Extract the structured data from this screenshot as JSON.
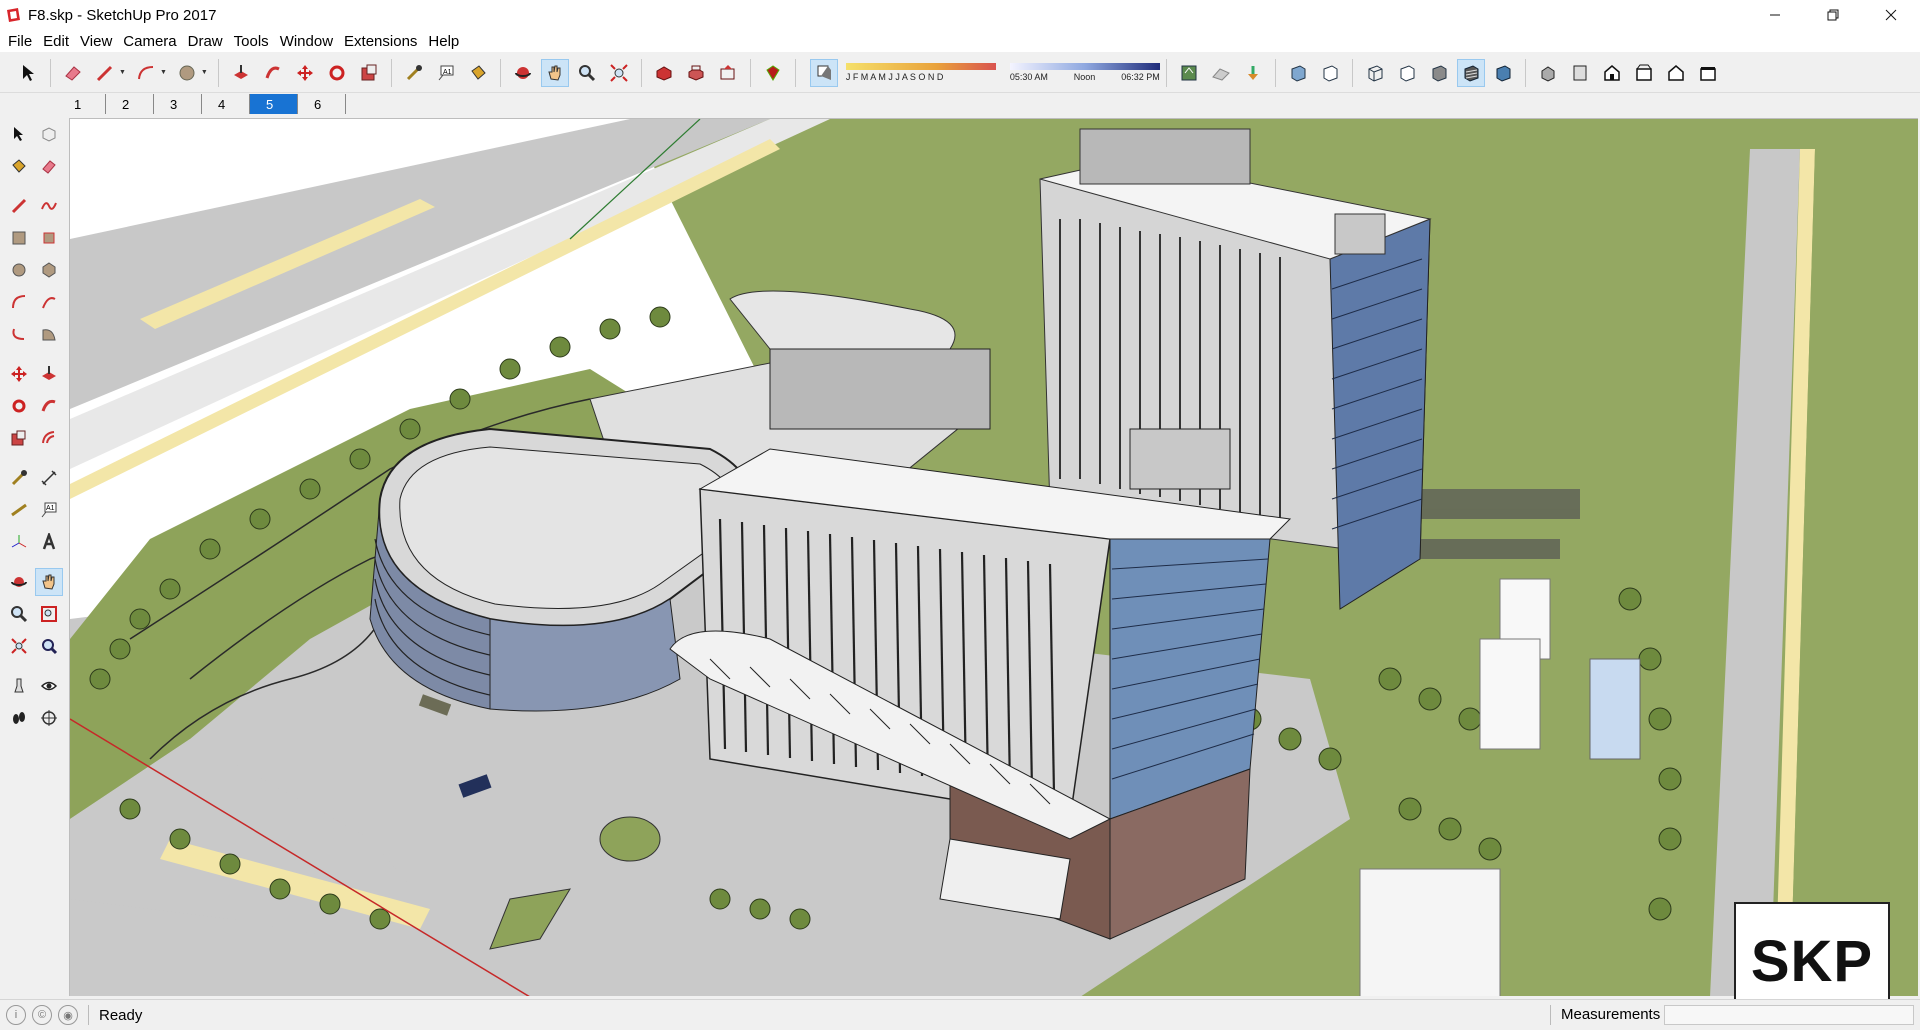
{
  "window": {
    "title": "F8.skp - SketchUp Pro 2017",
    "minimize_icon": "minimize-icon",
    "maximize_icon": "restore-icon",
    "close_icon": "close-icon"
  },
  "menu": {
    "items": [
      {
        "label": "File"
      },
      {
        "label": "Edit"
      },
      {
        "label": "View"
      },
      {
        "label": "Camera"
      },
      {
        "label": "Draw"
      },
      {
        "label": "Tools"
      },
      {
        "label": "Window"
      },
      {
        "label": "Extensions"
      },
      {
        "label": "Help"
      }
    ]
  },
  "toolbar": {
    "tools": [
      "select",
      "eraser",
      "line",
      "arc",
      "shapes",
      "push-pull",
      "follow-me",
      "move",
      "rotate",
      "scale",
      "tape-measure",
      "text",
      "paint-bucket",
      "orbit",
      "pan",
      "zoom",
      "zoom-extents",
      "3d-warehouse",
      "extension-warehouse",
      "layout",
      "ruby-console"
    ],
    "shadows": {
      "months": "J F M A M J J A S O N D",
      "time_start": "05:30 AM",
      "time_mid": "Noon",
      "time_end": "06:32 PM"
    },
    "styles": [
      "x-ray",
      "back-edges",
      "wireframe",
      "hidden-line",
      "shaded",
      "shaded-with-textures",
      "monochrome"
    ],
    "views": [
      "iso",
      "top",
      "front",
      "right",
      "back",
      "left"
    ]
  },
  "scenes": {
    "tabs": [
      {
        "label": "1"
      },
      {
        "label": "2"
      },
      {
        "label": "3"
      },
      {
        "label": "4"
      },
      {
        "label": "5"
      },
      {
        "label": "6"
      }
    ],
    "active_index": 4
  },
  "statusbar": {
    "status": "Ready",
    "measurements_label": "Measurements",
    "measurements_value": ""
  },
  "badge": {
    "text": "SKP"
  },
  "colors": {
    "lawn": "#8ea35a",
    "road": "#c9c9c9",
    "building_wall": "#d9d9d9",
    "roof": "#f4f4f4",
    "glass": "#6f8fb8",
    "active_tab": "#1873d3",
    "sand": "#f3e6a8"
  }
}
